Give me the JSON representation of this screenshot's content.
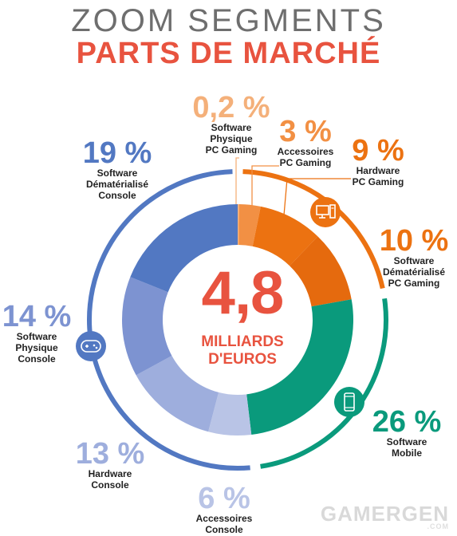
{
  "header": {
    "title_top": "ZOOM SEGMENTS",
    "title_main": "PARTS DE MARCHÉ"
  },
  "center": {
    "value": "4,8",
    "unit_line1": "MILLIARDS",
    "unit_line2": "D'EUROS"
  },
  "watermark": {
    "text": "GAMERGEN",
    "sub": ".COM"
  },
  "icons": {
    "pc": "desktop-computer-icon",
    "mobile": "smartphone-icon",
    "console": "gamepad-icon"
  },
  "colors": {
    "blue_ring": "#5278c2",
    "orange_ring": "#ec7211",
    "green_ring": "#0a9a7c",
    "title_red": "#e8533f"
  },
  "chart_data": {
    "type": "pie",
    "title": "PARTS DE MARCHÉ",
    "total": "4,8 MILLIARDS D'EUROS",
    "segments": [
      {
        "pct_label": "0,2 %",
        "value": 0.2,
        "line1": "Software",
        "line2": "Physique",
        "line3": "PC Gaming",
        "color": "#f4b07a"
      },
      {
        "pct_label": "3 %",
        "value": 3,
        "line1": "Accessoires",
        "line2": "PC Gaming",
        "line3": "",
        "color": "#f29044"
      },
      {
        "pct_label": "9 %",
        "value": 9,
        "line1": "Hardware",
        "line2": "PC Gaming",
        "line3": "",
        "color": "#ec7211"
      },
      {
        "pct_label": "10 %",
        "value": 10,
        "line1": "Software",
        "line2": "Dématérialisé",
        "line3": "PC Gaming",
        "color": "#e56a0e"
      },
      {
        "pct_label": "26 %",
        "value": 26,
        "line1": "Software",
        "line2": "Mobile",
        "line3": "",
        "color": "#0a9a7c"
      },
      {
        "pct_label": "6 %",
        "value": 6,
        "line1": "Accessoires",
        "line2": "Console",
        "line3": "",
        "color": "#b9c4e6"
      },
      {
        "pct_label": "13 %",
        "value": 13,
        "line1": "Hardware",
        "line2": "Console",
        "line3": "",
        "color": "#9eaedd"
      },
      {
        "pct_label": "14 %",
        "value": 14,
        "line1": "Software",
        "line2": "Physique",
        "line3": "Console",
        "color": "#7d93d1"
      },
      {
        "pct_label": "19 %",
        "value": 19,
        "line1": "Software",
        "line2": "Dématérialisé",
        "line3": "Console",
        "color": "#5278c2"
      }
    ]
  }
}
